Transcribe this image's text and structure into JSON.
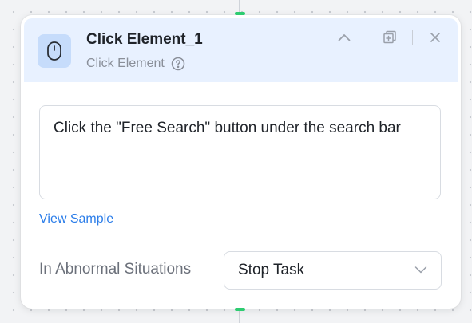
{
  "node": {
    "title": "Click Element_1",
    "type_label": "Click Element",
    "description": "Click the \"Free Search\" button under the search bar",
    "view_sample_label": "View Sample",
    "abnormal_label": "In Abnormal Situations",
    "abnormal_value": "Stop Task"
  },
  "icons": {
    "node": "mouse-icon",
    "help": "question-circle-icon",
    "collapse": "chevron-up-icon",
    "copy": "copy-add-icon",
    "close": "close-icon",
    "dropdown": "chevron-down-icon"
  },
  "colors": {
    "header_bg": "#e8f1ff",
    "icon_bg": "#c6dcfb",
    "link": "#2b7de9",
    "port": "#2ecc71"
  }
}
